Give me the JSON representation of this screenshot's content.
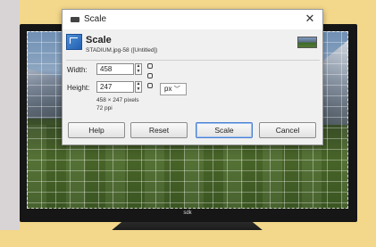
{
  "dialog": {
    "title": "Scale",
    "close_glyph": "✕",
    "heading": "Scale",
    "subtitle": "STADIUM.jpg-58 ([Untitled])"
  },
  "fields": {
    "width_label": "Width:",
    "width_value": "458",
    "height_label": "Height:",
    "height_value": "247",
    "unit_value": "px"
  },
  "info": {
    "pixels": "458 × 247 pixels",
    "ppi": "72 ppi"
  },
  "buttons": {
    "help": "Help",
    "reset": "Reset",
    "scale": "Scale",
    "cancel": "Cancel"
  },
  "monitor": {
    "brand_label": "sdk"
  },
  "icons": {
    "title_icon": "window-icon",
    "heading_icon": "scale-tool-icon",
    "chain_icon": "chain-link-icon",
    "unit_dropdown_icon": "chevron-down-icon",
    "image_thumbnail": "stadium-thumbnail"
  }
}
